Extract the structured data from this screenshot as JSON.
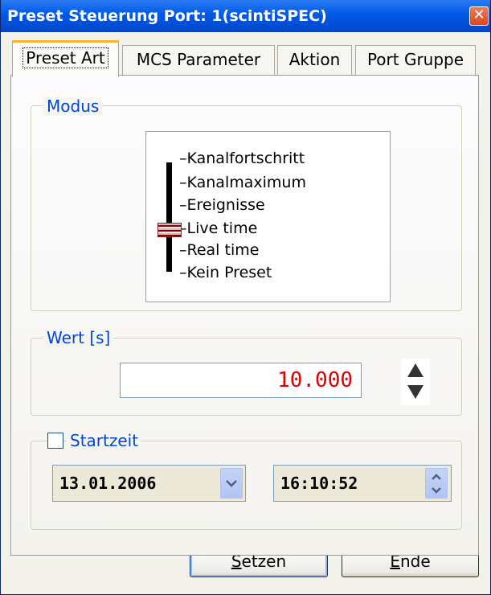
{
  "window": {
    "title": "Preset Steuerung Port: 1(scintiSPEC)",
    "close_glyph": "✕"
  },
  "tabs": [
    {
      "label": "Preset Art",
      "active": true
    },
    {
      "label": "MCS Parameter",
      "active": false
    },
    {
      "label": "Aktion",
      "active": false
    },
    {
      "label": "Port Gruppe",
      "active": false
    }
  ],
  "modus": {
    "label": "Modus",
    "options": [
      "Kanalfortschritt",
      "Kanalmaximum",
      "Ereignisse",
      "Live time",
      "Real time",
      "Kein Preset"
    ],
    "selected": "Live time"
  },
  "wert": {
    "label": "Wert [s]",
    "value": "10.000"
  },
  "startzeit": {
    "label": "Startzeit",
    "checked": false,
    "date": "13.01.2006",
    "time": "16:10:52"
  },
  "buttons": {
    "setzen_first": "S",
    "setzen_rest": "etzen",
    "ende_first": "E",
    "ende_rest": "nde"
  },
  "colors": {
    "title_bar": "#0058e6",
    "value_text": "#e00000",
    "group_label": "#0046d5"
  },
  "icons": [
    "close-icon",
    "chevron-down-icon",
    "spin-up-icon",
    "spin-down-icon"
  ]
}
